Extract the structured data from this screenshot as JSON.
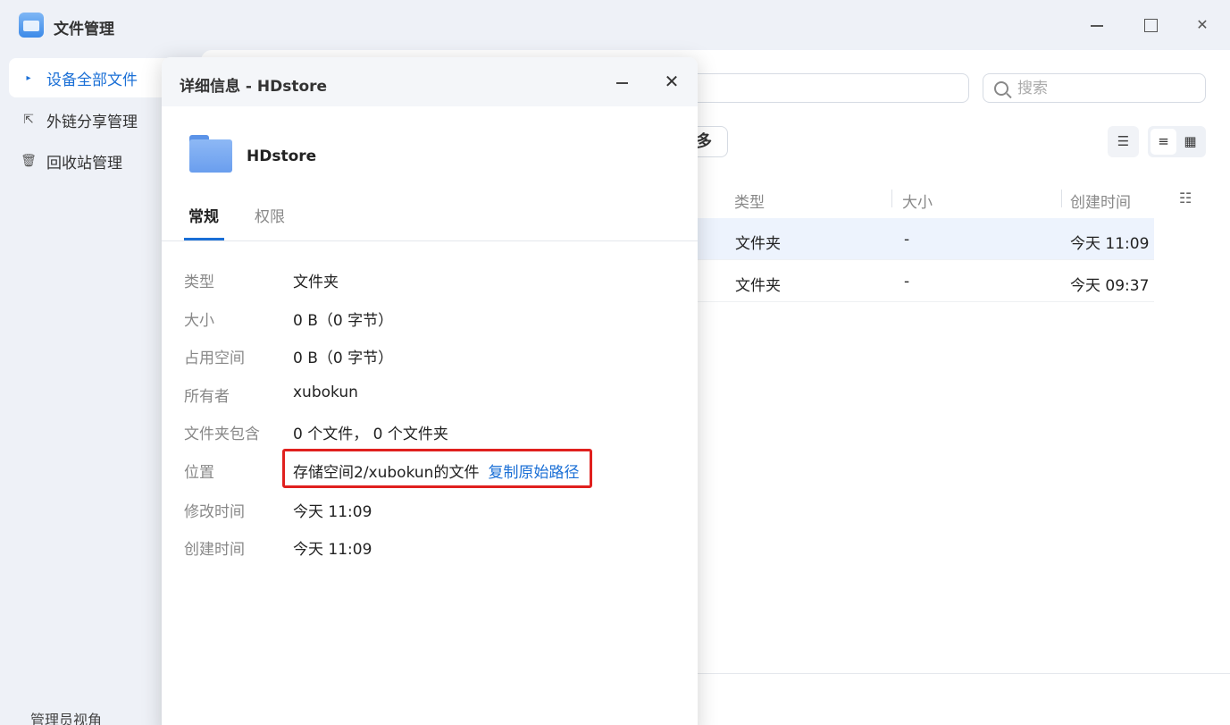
{
  "app": {
    "title": "文件管理"
  },
  "sidebar": {
    "items": [
      {
        "label": "设备全部文件",
        "icon": "chevron-right-icon"
      },
      {
        "label": "外链分享管理",
        "icon": "share-icon"
      },
      {
        "label": "回收站管理",
        "icon": "trash-icon"
      }
    ],
    "bottom_label": "管理员视角"
  },
  "main": {
    "search_placeholder": "搜索",
    "more_label": "多",
    "columns": {
      "type": "类型",
      "size": "大小",
      "created": "创建时间"
    },
    "rows": [
      {
        "type": "文件夹",
        "size": "-",
        "created": "今天 11:09"
      },
      {
        "type": "文件夹",
        "size": "-",
        "created": "今天 09:37"
      }
    ]
  },
  "dialog": {
    "title": "详细信息 - HDstore",
    "folder_name": "HDstore",
    "tabs": {
      "general": "常规",
      "permissions": "权限"
    },
    "fields": {
      "type_label": "类型",
      "type_value": "文件夹",
      "size_label": "大小",
      "size_value": "0 B（0 字节）",
      "used_label": "占用空间",
      "used_value": "0 B（0 字节）",
      "owner_label": "所有者",
      "owner_value": "xubokun",
      "contains_label": "文件夹包含",
      "contains_value": "0 个文件， 0 个文件夹",
      "location_label": "位置",
      "location_value": "存储空间2/xubokun的文件",
      "copy_path": "复制原始路径",
      "modified_label": "修改时间",
      "modified_value": "今天 11:09",
      "created_label": "创建时间",
      "created_value": "今天 11:09"
    }
  },
  "colors": {
    "accent": "#1a6fd6",
    "highlight": "#e0201e"
  }
}
